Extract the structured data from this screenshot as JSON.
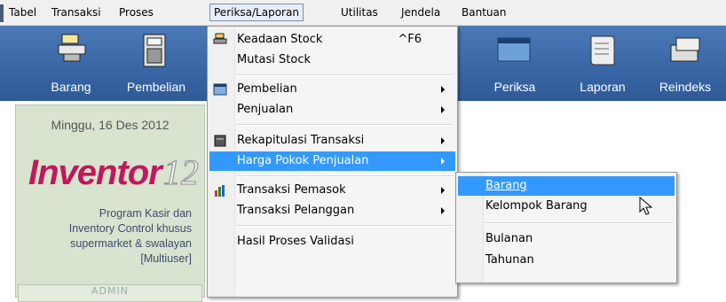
{
  "menubar": {
    "items": [
      "Tabel",
      "Transaksi",
      "Proses",
      "Periksa/Laporan",
      "Utilitas",
      "Jendela",
      "Bantuan"
    ]
  },
  "toolbar": {
    "buttons": [
      "Barang",
      "Pembelian",
      "Periksa",
      "Laporan",
      "Reindeks"
    ]
  },
  "left_panel": {
    "date": "Minggu, 16 Des 2012",
    "logo_text": "Inventor",
    "logo_number": "12",
    "desc_lines": [
      "Program Kasir dan",
      "Inventory Control khusus",
      "supermarket & swalayan",
      "[Multiuser]"
    ],
    "user": "ADMIN"
  },
  "main_menu": {
    "items": [
      {
        "label": "Keadaan Stock",
        "shortcut": "^F6"
      },
      {
        "label": "Mutasi Stock"
      },
      {
        "label": "Pembelian"
      },
      {
        "label": "Penjualan"
      },
      {
        "label": "Rekapitulasi Transaksi"
      },
      {
        "label": "Harga Pokok Penjualan"
      },
      {
        "label": "Transaksi Pemasok"
      },
      {
        "label": "Transaksi Pelanggan"
      },
      {
        "label": "Hasil Proses Validasi"
      }
    ]
  },
  "sub_menu": {
    "items": [
      "Barang",
      "Kelompok Barang",
      "Bulanan",
      "Tahunan"
    ]
  },
  "colors": {
    "highlight": "#3399ff",
    "toolbar": "#3a67a6",
    "logo": "#c2185b"
  }
}
